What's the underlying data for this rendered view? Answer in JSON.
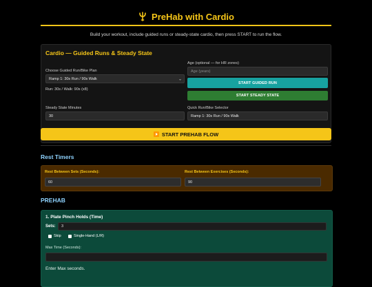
{
  "header": {
    "title": "PreHab with Cardio",
    "icon": "trident-icon",
    "accent": "#f5c518"
  },
  "subtitle": "Build your workout, include guided runs or steady-state cardio, then press START to run the flow.",
  "cardio": {
    "title": "Cardio — Guided Runs & Steady State",
    "plan_label": "Choose Guided Run/Bike Plan",
    "plan_value": "Ramp 1: 30s Run / 90s Walk",
    "plan_info": "Run: 30s / Walk: 90s (x8)",
    "age_label": "Age (optional — for HR zones)",
    "age_placeholder": "Age (years)",
    "start_guided": "START GUIDED RUN",
    "start_steady": "START STEADY STATE",
    "steady_label": "Steady State Minutes",
    "steady_value": "30",
    "quick_label": "Quick Run/Bike Selector",
    "quick_value": "Ramp 1: 30s Run / 90s Walk"
  },
  "start_flow": "START PREHAB FLOW",
  "rest": {
    "title": "Rest Timers",
    "sets_label": "Rest Between Sets (Seconds):",
    "sets_value": "60",
    "ex_label": "Rest Between Exercises (Seconds):",
    "ex_value": "90"
  },
  "prehab": {
    "title": "PREHAB",
    "exercise": {
      "name": "1. Plate Pinch Holds (Time)",
      "sets_label": "Sets:",
      "sets_value": "3",
      "skip_label": "Skip",
      "single_hand_label": "Single-Hand (L/R)",
      "max_label": "Max Time (Seconds):",
      "hint": "Enter Max seconds."
    }
  },
  "colors": {
    "teal_button": "#17a2a0",
    "green_button": "#2e7d32",
    "rest_panel": "#4a2a00",
    "prehab_panel": "#0c4a3a",
    "section_title": "#8fd3ff"
  }
}
